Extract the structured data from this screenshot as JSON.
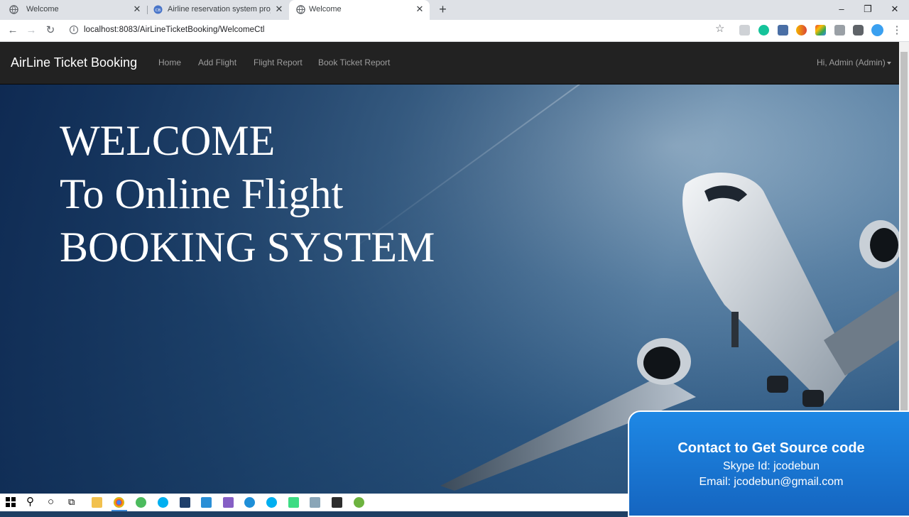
{
  "browser": {
    "tabs": [
      {
        "title": "Welcome",
        "active": false
      },
      {
        "title": "Airline reservation system projec",
        "active": false
      },
      {
        "title": "Welcome",
        "active": true
      }
    ],
    "new_tab_symbol": "+",
    "url": "localhost:8083/AirLineTicketBooking/WelcomeCtl",
    "window_controls": [
      "–",
      "❐",
      "✕"
    ]
  },
  "navbar": {
    "brand": "AirLine Ticket Booking",
    "links": [
      "Home",
      "Add Flight",
      "Flight Report",
      "Book Ticket Report"
    ],
    "user_menu": "Hi, Admin (Admin)"
  },
  "hero": {
    "lines": [
      "WELCOME",
      "To Online Flight",
      "BOOKING SYSTEM"
    ]
  },
  "promo": {
    "title": "Contact to Get Source code",
    "skype": "Skype Id: jcodebun",
    "email": "Email: jcodebun@gmail.com"
  },
  "colors": {
    "navbar_bg": "#222222",
    "nav_link": "#9d9d9d",
    "promo_bg": "#1e88e5"
  },
  "icons": {
    "taskbar": [
      "windows-start-icon",
      "search-icon",
      "cortana-icon",
      "task-view-icon",
      "file-explorer-icon",
      "chrome-icon",
      "eclipse-icon",
      "skype-icon",
      "terminal-icon",
      "vscode-icon",
      "visual-studio-icon",
      "edge-icon",
      "skype-icon",
      "android-studio-icon",
      "notepad-icon",
      "java-icon",
      "spring-icon"
    ]
  }
}
